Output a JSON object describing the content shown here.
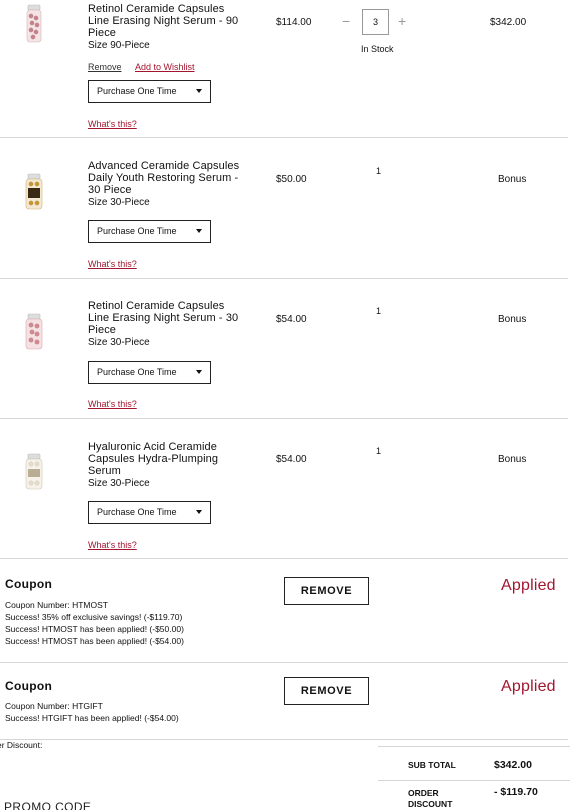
{
  "items": [
    {
      "name": "Retinol Ceramide Capsules Line Erasing Night Serum - 90 Piece",
      "size": "Size 90-Piece",
      "price": "$114.00",
      "qty": "3",
      "stock": "In Stock",
      "total": "$342.00",
      "remove": "Remove",
      "wishlist": "Add to Wishlist",
      "purchase": "Purchase One Time",
      "whats": "What's this?",
      "capsule_color": "#c8828a"
    },
    {
      "name": "Advanced Ceramide Capsules Daily Youth Restoring Serum - 30 Piece",
      "size": "Size 30-Piece",
      "price": "$50.00",
      "qty": "1",
      "total": "Bonus",
      "purchase": "Purchase One Time",
      "whats": "What's this?",
      "capsule_color": "#c8982e"
    },
    {
      "name": "Retinol Ceramide Capsules Line Erasing Night Serum - 30 Piece",
      "size": "Size 30-Piece",
      "price": "$54.00",
      "qty": "1",
      "total": "Bonus",
      "purchase": "Purchase One Time",
      "whats": "What's this?",
      "capsule_color": "#d28a90"
    },
    {
      "name": "Hyaluronic Acid Ceramide Capsules Hydra-Plumping Serum",
      "size": "Size 30-Piece",
      "price": "$54.00",
      "qty": "1",
      "total": "Bonus",
      "purchase": "Purchase One Time",
      "whats": "What's this?",
      "capsule_color": "#e6dcc8"
    }
  ],
  "coupons": [
    {
      "title": "Coupon",
      "number": "Coupon Number: HTMOST",
      "lines": [
        "Success! 35% off exclusive savings! (-$119.70)",
        "Success! HTMOST has been applied! (-$50.00)",
        "Success! HTMOST has been applied! (-$54.00)"
      ],
      "button": "REMOVE",
      "status": "Applied"
    },
    {
      "title": "Coupon",
      "number": "Coupon Number: HTGIFT",
      "lines": [
        "Success! HTGIFT has been applied! (-$54.00)"
      ],
      "button": "REMOVE",
      "status": "Applied"
    }
  ],
  "summary": {
    "discount_label": "er Discount:",
    "subtotal_label": "SUB TOTAL",
    "subtotal_value": "$342.00",
    "order_discount_label_1": "ORDER",
    "order_discount_label_2": "DISCOUNT",
    "order_discount_value": "- $119.70",
    "promo_label": "PROMO CODE"
  },
  "colors": {
    "accent": "#a3152f",
    "border": "#d6d6d6"
  }
}
